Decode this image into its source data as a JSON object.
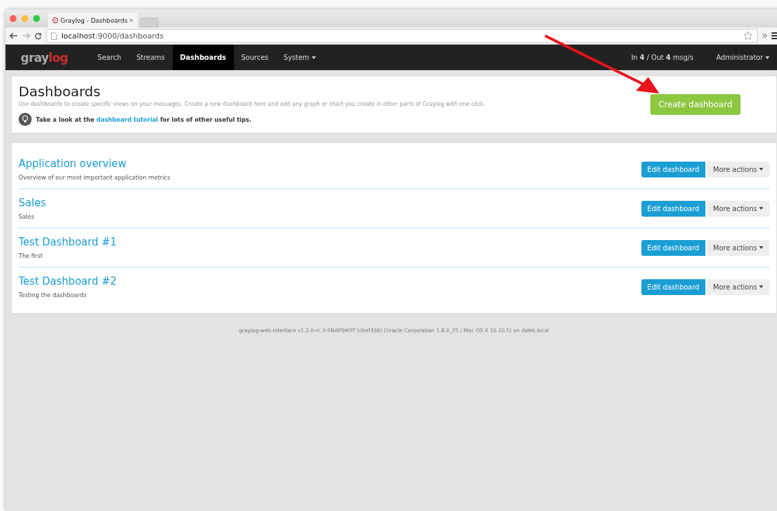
{
  "browser": {
    "tab_title": "Graylog - Dashboards",
    "url_host": "localhost",
    "url_path": ":9000/dashboards"
  },
  "navbar": {
    "logo_first": "gray",
    "logo_second": "log",
    "items": [
      {
        "label": "Search",
        "selected": false,
        "dropdown": false
      },
      {
        "label": "Streams",
        "selected": false,
        "dropdown": false
      },
      {
        "label": "Dashboards",
        "selected": true,
        "dropdown": false
      },
      {
        "label": "Sources",
        "selected": false,
        "dropdown": false
      },
      {
        "label": "System",
        "selected": false,
        "dropdown": true
      }
    ],
    "throughput": "In **4** / Out **4** msg/s",
    "user": "Administrator"
  },
  "header": {
    "title": "Dashboards",
    "description": "Use dashboards to create specific views on your messages. Create a new dashboard here and add any graph or chart you create in other parts of Graylog with one click.",
    "tip_before": "Take a look at the",
    "tip_link": "dashboard tutorial",
    "tip_after": "for lots of other useful tips.",
    "create_button": "Create dashboard"
  },
  "dashboards": [
    {
      "title": "Application overview",
      "description": "Overview of our most important application metrics",
      "edit_button": "Edit dashboard",
      "more_button": "More actions"
    },
    {
      "title": "Sales",
      "description": "Sales",
      "edit_button": "Edit dashboard",
      "more_button": "More actions"
    },
    {
      "title": "Test Dashboard #1",
      "description": "The first",
      "edit_button": "Edit dashboard",
      "more_button": "More actions"
    },
    {
      "title": "Test Dashboard #2",
      "description": "Testing the dashboards",
      "edit_button": "Edit dashboard",
      "more_button": "More actions"
    }
  ],
  "footer": "graylog-web-interface v1.2.0-rc.3-SNAPSHOT (cbef336) (Oracle Corporation 1.8.0_25 / Mac OS X 10.10.5) on dalek.local"
}
